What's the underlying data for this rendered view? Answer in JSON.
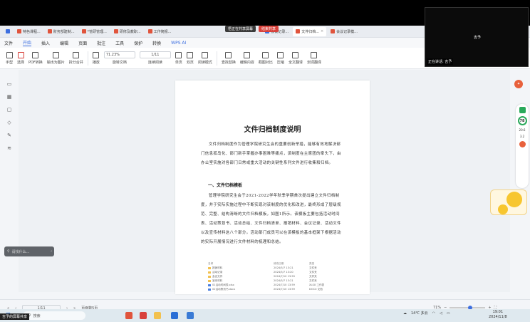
{
  "meeting": {
    "share_title": "悟正在共享屏幕",
    "end_share": "结束共享",
    "participant_name": "吉予",
    "speaking_label": "正在讲话: 吉予",
    "screen_label": "吉予的屏幕共享"
  },
  "tabs": [
    {
      "label": "特色课程..."
    },
    {
      "label": "财务部建制..."
    },
    {
      "label": "*管研管理..."
    },
    {
      "label": "研修及教职..."
    },
    {
      "label": "工作简报..."
    },
    {
      "label": "会议记录..."
    },
    {
      "label": "文件归档..."
    },
    {
      "label": "会议记录模..."
    }
  ],
  "menu": {
    "file": "文件",
    "items": [
      "开始",
      "插入",
      "编辑",
      "页面",
      "批注",
      "工具",
      "保护",
      "转换"
    ],
    "wps_ai": "WPS AI"
  },
  "toolbar": {
    "hand": "手型",
    "select": "选择",
    "pdf_convert": "PDF转换",
    "export_image": "输出为图片",
    "split_merge": "拆分合并",
    "play": "播放",
    "zoom": "71.23%",
    "page": "1/11",
    "rotate": "旋转文档",
    "single": "单页",
    "double": "双页",
    "continuous": "连续阅读",
    "read_mode": "阅读模式",
    "find_replace": "查找替换",
    "edit_content": "编辑内容",
    "screenshot": "截图对比",
    "compress": "压缩",
    "full_translate": "全文翻译",
    "word_translate": "划词翻译"
  },
  "document": {
    "title": "文件归档制度说明",
    "para1": "文件归档制度作为管理学院研究生会的重要创新举措，能够有效地解决部门信息孤岛化、部门新手掌握办事困难等痛点，该制度在主席团的牵头下，由办公室实施对各部门日常或重大活动的关键性系列文件进行收集和归档。",
    "heading1": "一、文件归档模板",
    "para2": "管理学院研究生会于2021-2022学年秋季学期首次提出建立文件归档制度，并于实际实施过程中不断实现对该制度的优化和改进，最终形成了层级规范、完整、结构清晰的文件归档模板，如图1所示。该模板主要包括活动时间表、活动策划书、活动总结、文件归档清单、报销材料、会议记录、活动文件以及宣传材料这八个部分。活动部门成员可以在该模板的基本框架下根据活动的实际开展情况进行文件材料的梳理和总结。",
    "table_headers": [
      "名称",
      "修改日期",
      "类型"
    ],
    "table_rows": [
      {
        "name": "报销材料",
        "date": "2024/5/7 13:21",
        "type": "文件夹"
      },
      {
        "name": "活动记录",
        "date": "2024/5/7 13:20",
        "type": "文件夹"
      },
      {
        "name": "会议文件",
        "date": "2024/7/10 13:59",
        "type": "文件夹"
      },
      {
        "name": "宣传材料",
        "date": "2024/5/7 13:21",
        "type": "文件夹"
      },
      {
        "name": "01活动时间表.xlsx",
        "date": "2024/7/10 13:59",
        "type": "XLSX 工作表"
      },
      {
        "name": "02活动策划书.docx",
        "date": "2024/7/10 13:59",
        "type": "DOCX 文档"
      }
    ]
  },
  "side_panel": {
    "score": "78",
    "stat1": "20.6",
    "stat2": "3.2"
  },
  "search_bubble": "请找什么...",
  "status": {
    "page": "1/11",
    "total": "页面数5页",
    "zoom": "71%"
  },
  "taskbar": {
    "search": "搜索",
    "weather": "14℃ 多云",
    "time": "19:01",
    "date": "2024/11/8"
  }
}
